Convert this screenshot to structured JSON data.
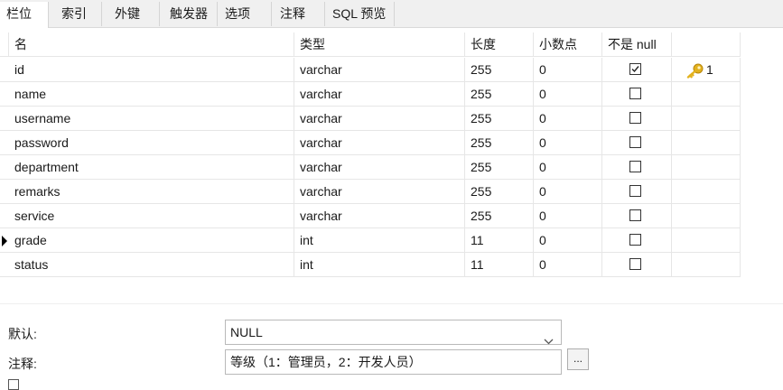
{
  "tabs": [
    {
      "label": "栏位",
      "active": true
    },
    {
      "label": "索引",
      "active": false
    },
    {
      "label": "外键",
      "active": false
    },
    {
      "label": "触发器",
      "active": false
    },
    {
      "label": "选项",
      "active": false
    },
    {
      "label": "注释",
      "active": false
    },
    {
      "label": "SQL 预览",
      "active": false
    }
  ],
  "grid": {
    "headers": [
      "名",
      "类型",
      "长度",
      "小数点",
      "不是 null",
      ""
    ],
    "rows": [
      {
        "name": "id",
        "type": "varchar",
        "length": "255",
        "decimal": "0",
        "not_null": true,
        "key": "1",
        "current": false
      },
      {
        "name": "name",
        "type": "varchar",
        "length": "255",
        "decimal": "0",
        "not_null": false,
        "key": "",
        "current": false
      },
      {
        "name": "username",
        "type": "varchar",
        "length": "255",
        "decimal": "0",
        "not_null": false,
        "key": "",
        "current": false
      },
      {
        "name": "password",
        "type": "varchar",
        "length": "255",
        "decimal": "0",
        "not_null": false,
        "key": "",
        "current": false
      },
      {
        "name": "department",
        "type": "varchar",
        "length": "255",
        "decimal": "0",
        "not_null": false,
        "key": "",
        "current": false
      },
      {
        "name": "remarks",
        "type": "varchar",
        "length": "255",
        "decimal": "0",
        "not_null": false,
        "key": "",
        "current": false
      },
      {
        "name": "service",
        "type": "varchar",
        "length": "255",
        "decimal": "0",
        "not_null": false,
        "key": "",
        "current": false
      },
      {
        "name": "grade",
        "type": "int",
        "length": "11",
        "decimal": "0",
        "not_null": false,
        "key": "",
        "current": true
      },
      {
        "name": "status",
        "type": "int",
        "length": "11",
        "decimal": "0",
        "not_null": false,
        "key": "",
        "current": false
      }
    ]
  },
  "properties": {
    "default_label": "默认:",
    "default_value": "NULL",
    "comment_label": "注释:",
    "comment_value": "等级（1：管理员，2：开发人员）",
    "browse_button": "..."
  },
  "icons": {
    "key": "key-icon",
    "current_row": "row-pointer-icon",
    "dropdown": "chevron-down-icon",
    "checkbox": "checkbox-icon"
  },
  "colors": {
    "key_gold": "#e3b21e",
    "tab_bar": "#f0f0f0",
    "grid_line": "#e6e6e6"
  }
}
